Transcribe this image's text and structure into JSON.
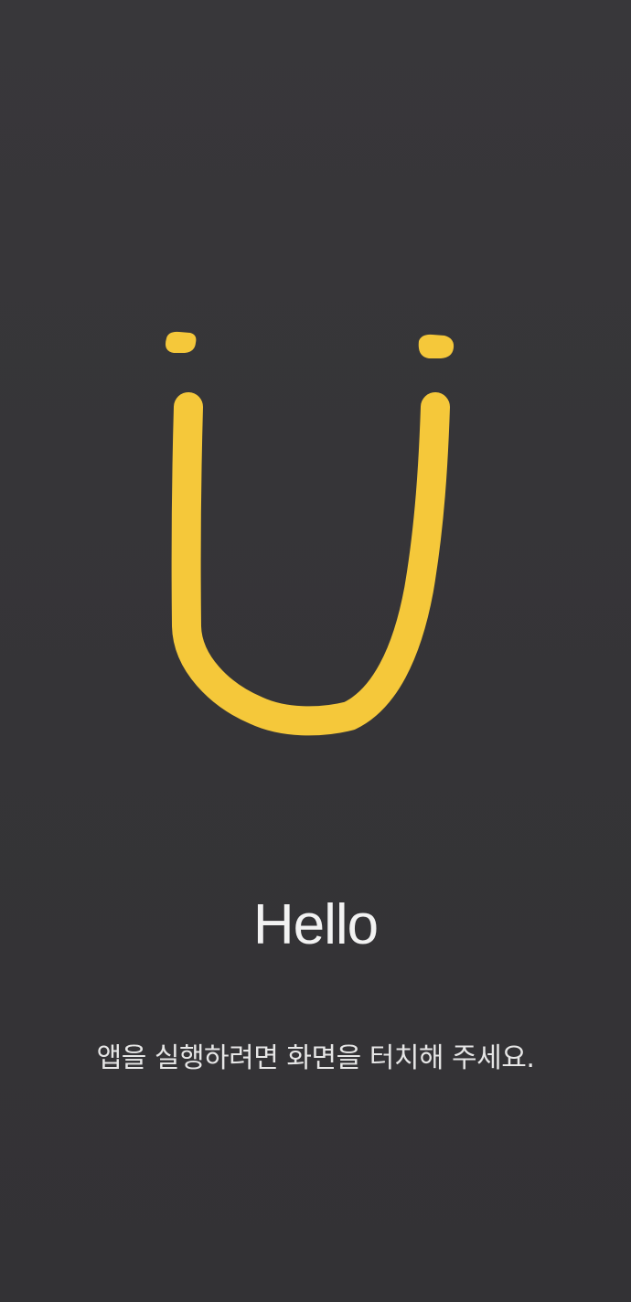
{
  "splash": {
    "logo_icon": "yellow-smile-u-icon",
    "accent_color": "#F5C83A",
    "greeting": "Hello",
    "instruction": "앱을 실행하려면 화면을 터치해 주세요."
  }
}
